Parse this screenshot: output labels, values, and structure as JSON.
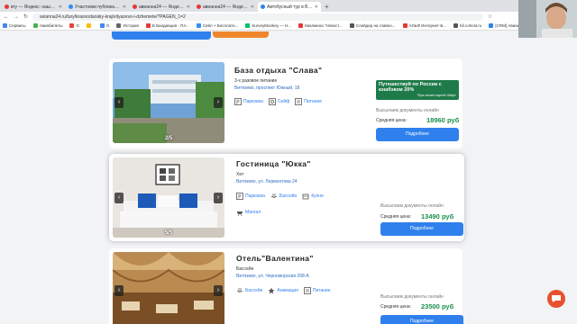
{
  "browser": {
    "tabs": [
      {
        "label": "вгу — Яндекс: нашлось 4 млн",
        "color": "#e53935",
        "active": false
      },
      {
        "label": "Участники публикации - Zoom",
        "color": "#2d8cff",
        "active": false
      },
      {
        "label": "авианна24 — Яндекс: нашлось",
        "color": "#e53935",
        "active": false
      },
      {
        "label": "авианна24 — Яндекс: нашлось",
        "color": "#e53935",
        "active": false
      },
      {
        "label": "Автобусный тур в Витязево из",
        "color": "#2f80ed",
        "active": true
      }
    ],
    "new_tab": "+",
    "url": "avianna24.ru/tury/krasnodarskiy-kraj/vityazevo-i-dzhemete/?PAGEN_1=2",
    "bookmarks": [
      {
        "label": "Сервисы",
        "color": "#4285f4"
      },
      {
        "label": "Авиабилеты",
        "color": "#4caf50"
      },
      {
        "label": "G",
        "color": "#ea4335"
      },
      {
        "label": "",
        "color": "#fbbc05"
      },
      {
        "label": "G",
        "color": "#4285f4"
      },
      {
        "label": "История",
        "color": "#666666"
      },
      {
        "label": "Б Биодиация - Пл...",
        "color": "#e53935"
      },
      {
        "label": "Сейл + Бесплатн...",
        "color": "#2d8cff"
      },
      {
        "label": "SurveyMonkey — Н...",
        "color": "#00bf6f"
      },
      {
        "label": "Квалмена \"Новост...",
        "color": "#e53935"
      },
      {
        "label": "Слейдер на главно...",
        "color": "#555555"
      },
      {
        "label": "АЛЬФ Интернет-Б...",
        "color": "#e53935"
      },
      {
        "label": "bil.cohost.ru",
        "color": "#555555"
      },
      {
        "label": "[CRM] Авиания",
        "color": "#2f80ed"
      },
      {
        "label": "Сбербанк",
        "color": "#21a038"
      }
    ]
  },
  "hotels": [
    {
      "title": "База отдыха \"Слава\"",
      "subtitle": "3-х разовое питание",
      "address": "Витязево, проспект Южный, 18",
      "amenities": [
        "Парковка",
        "Сейф",
        "Питание"
      ],
      "promo_title": "Путешествуй по России с кэшбэком 20%",
      "promo_note": "*При оплате картой «Мир»",
      "docs": "Высылаем документы онлайн",
      "price_label": "Средняя цена:",
      "price": "18960 руб",
      "button": "Подробнее",
      "photo_counter": "2/5",
      "arrow_left": "‹",
      "arrow_right": "›"
    },
    {
      "title": "Гостиница \"Юкка\"",
      "subtitle": "Хит",
      "address": "Витязево, ул. Лермонтова 24",
      "amenities": [
        "Парковка",
        "Бассейн",
        "Кухня",
        "Мангал"
      ],
      "docs": "Высылаем документы онлайн",
      "price_label": "Средняя цена:",
      "price": "13490 руб",
      "button": "Подробнее",
      "photo_counter": "5/5",
      "arrow_left": "‹",
      "arrow_right": "›"
    },
    {
      "title": "Отель\"Валентина\"",
      "subtitle": "Бассейн",
      "address": "Витязево, ул. Черноморская 208-А",
      "amenities": [
        "Бассейн",
        "Анимация",
        "Питание"
      ],
      "docs": "Высылаем документы онлайн",
      "price_label": "Средняя цена:",
      "price": "23500 руб",
      "button": "Подробнее",
      "photo_counter": "",
      "arrow_left": "‹",
      "arrow_right": "›"
    }
  ],
  "colors": {
    "accent": "#2f80ed",
    "price": "#1a8f4c",
    "promo": "#1f7a4a",
    "top_orange": "#f0862b",
    "chat": "#e8502e"
  }
}
